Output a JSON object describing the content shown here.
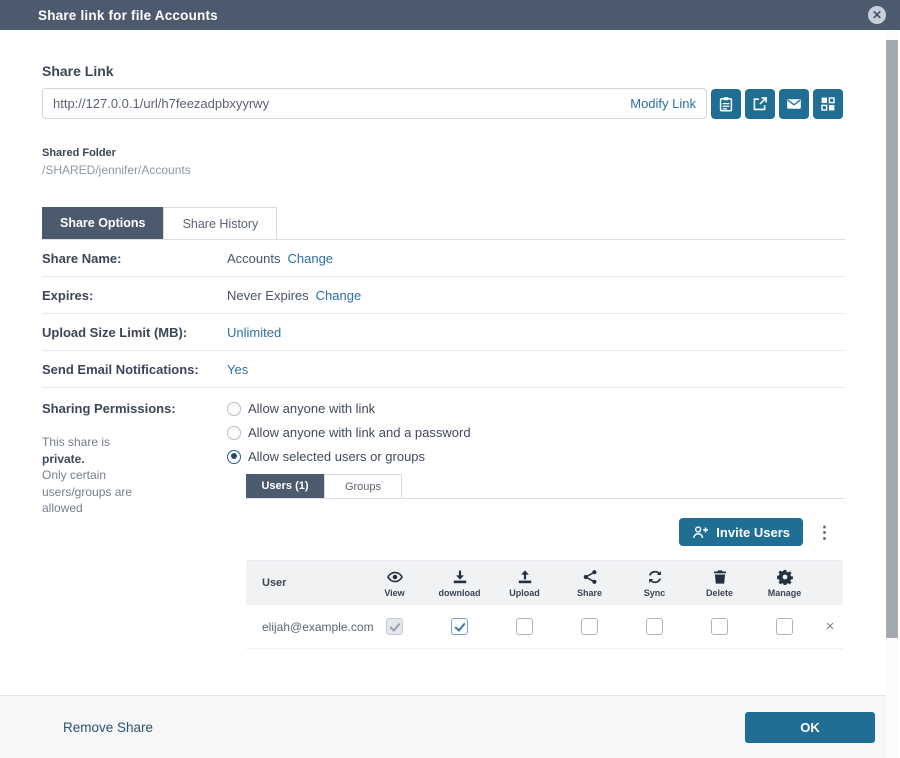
{
  "colors": {
    "header_bg": "#4c5a6e",
    "accent_blue": "#216e95",
    "link_blue": "#2e6fa5",
    "active_tab_bg": "#4c5a6e",
    "table_header_bg": "#f1f2f4"
  },
  "header": {
    "title": "Share link for file Accounts",
    "close_icon": "x-circle-icon"
  },
  "share_link": {
    "label": "Share Link",
    "url": "http://127.0.0.1/url/h7feezadpbxyyrwy",
    "modify_label": "Modify Link",
    "buttons": [
      {
        "name": "copy-link-button",
        "icon": "clipboard"
      },
      {
        "name": "open-link-button",
        "icon": "external-link"
      },
      {
        "name": "email-link-button",
        "icon": "envelope"
      },
      {
        "name": "embed-link-button",
        "icon": "grid"
      }
    ]
  },
  "shared_folder": {
    "label": "Shared Folder",
    "path": "/SHARED/jennifer/Accounts"
  },
  "tabs": [
    {
      "label": "Share Options",
      "active": true
    },
    {
      "label": "Share History",
      "active": false
    }
  ],
  "options": [
    {
      "label": "Share Name:",
      "value": "Accounts",
      "action": "Change"
    },
    {
      "label": "Expires:",
      "value": "Never Expires",
      "action": "Change"
    },
    {
      "label": "Upload Size Limit (MB):",
      "value_link": "Unlimited"
    },
    {
      "label": "Send Email Notifications:",
      "value_link": "Yes"
    }
  ],
  "permissions": {
    "label": "Sharing Permissions:",
    "radios": [
      {
        "label": "Allow anyone with link",
        "selected": false
      },
      {
        "label": "Allow anyone with link and a password",
        "selected": false
      },
      {
        "label": "Allow selected users or groups",
        "selected": true
      }
    ],
    "note_lines": [
      {
        "text": "This share is",
        "bold": false
      },
      {
        "text": "private.",
        "bold": true
      },
      {
        "text": "Only certain",
        "bold": false
      },
      {
        "text": "users/groups are",
        "bold": false
      },
      {
        "text": "allowed",
        "bold": false
      }
    ],
    "sub_tabs": [
      {
        "label": "Users (1)",
        "active": true
      },
      {
        "label": "Groups",
        "active": false
      }
    ],
    "invite_button_label": "Invite Users",
    "kebab_icon": "vertical-ellipsis-icon"
  },
  "table": {
    "user_header": "User",
    "columns": [
      {
        "label": "View",
        "icon": "eye"
      },
      {
        "label": "download",
        "icon": "download"
      },
      {
        "label": "Upload",
        "icon": "upload"
      },
      {
        "label": "Share",
        "icon": "share"
      },
      {
        "label": "Sync",
        "icon": "sync"
      },
      {
        "label": "Delete",
        "icon": "trash"
      },
      {
        "label": "Manage",
        "icon": "gear"
      }
    ],
    "rows": [
      {
        "user": "elijah@example.com",
        "permissions": [
          {
            "checked": true,
            "disabled": true
          },
          {
            "checked": true,
            "disabled": false
          },
          {
            "checked": false,
            "disabled": false
          },
          {
            "checked": false,
            "disabled": false
          },
          {
            "checked": false,
            "disabled": false
          },
          {
            "checked": false,
            "disabled": false
          },
          {
            "checked": false,
            "disabled": false
          }
        ],
        "remove_label": "×"
      }
    ]
  },
  "footer": {
    "remove_label": "Remove Share",
    "ok_label": "OK"
  }
}
